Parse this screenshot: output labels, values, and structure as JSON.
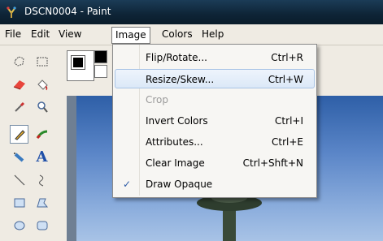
{
  "window": {
    "title": "DSCN0004 - Paint"
  },
  "menubar": {
    "items": [
      "File",
      "Edit",
      "View",
      "Image",
      "Colors",
      "Help"
    ]
  },
  "image_menu": {
    "items": [
      {
        "label": "Flip/Rotate...",
        "shortcut": "Ctrl+R"
      },
      {
        "label": "Resize/Skew...",
        "shortcut": "Ctrl+W"
      },
      {
        "label": "Crop",
        "shortcut": ""
      },
      {
        "label": "Invert Colors",
        "shortcut": "Ctrl+I"
      },
      {
        "label": "Attributes...",
        "shortcut": "Ctrl+E"
      },
      {
        "label": "Clear Image",
        "shortcut": "Ctrl+Shft+N"
      },
      {
        "label": "Draw Opaque",
        "shortcut": "",
        "checked": true
      }
    ]
  },
  "tools": [
    "free-form-select-icon",
    "select-icon",
    "eraser-icon",
    "fill-icon",
    "color-picker-icon",
    "magnifier-icon",
    "pencil-icon",
    "brush-icon",
    "airbrush-icon",
    "text-icon",
    "line-icon",
    "curve-icon",
    "rectangle-icon",
    "polygon-icon",
    "ellipse-icon",
    "rounded-rectangle-icon"
  ],
  "colors": {
    "titlebar": "#0e2436",
    "menu_hover": "#dbe8f7",
    "sky": "#5b86c8"
  }
}
